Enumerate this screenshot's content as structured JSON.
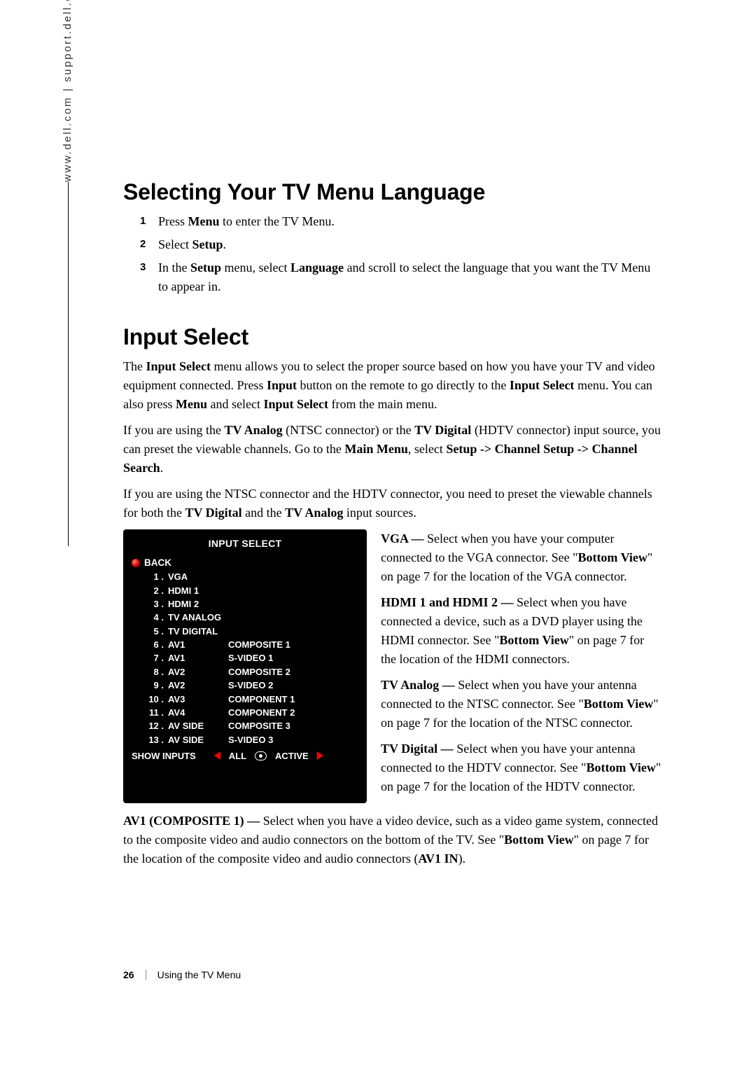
{
  "side_url": "www.dell.com | support.dell.com",
  "h1_a": "Selecting Your TV Menu Language",
  "steps": [
    {
      "n": "1",
      "t": "Press <b>Menu</b> to enter the TV Menu."
    },
    {
      "n": "2",
      "t": "Select <b>Setup</b>."
    },
    {
      "n": "3",
      "t": "In the <b>Setup</b> menu, select <b>Language</b> and scroll to select the language that you want the TV Menu to appear in."
    }
  ],
  "h1_b": "Input Select",
  "p1": "The <b>Input Select</b> menu allows you to select the proper source based on how you have your TV and video equipment connected. Press <b>Input</b> button on the remote to go directly to the <b>Input Select</b> menu. You can also press <b>Menu</b> and select <b>Input Select</b> from the main menu.",
  "p2": "If you are using the <b>TV Analog</b> (NTSC connector) or the <b>TV Digital</b> (HDTV connector) input source, you can preset the viewable channels. Go to the <b>Main Menu</b>, select <b>Setup -> Channel Setup -> Channel Search</b>.",
  "p3": "If you are using the NTSC connector and the HDTV connector, you need to preset the viewable channels for both the <b>TV Digital</b> and the <b>TV Analog</b> input sources.",
  "menu": {
    "title": "INPUT SELECT",
    "back": "BACK",
    "rows": [
      {
        "n": "1 .",
        "l": "VGA",
        "v": ""
      },
      {
        "n": "2 .",
        "l": "HDMI 1",
        "v": ""
      },
      {
        "n": "3 .",
        "l": "HDMI 2",
        "v": ""
      },
      {
        "n": "4 .",
        "l": "TV ANALOG",
        "v": ""
      },
      {
        "n": "5 .",
        "l": "TV DIGITAL",
        "v": ""
      },
      {
        "n": "6 .",
        "l": "AV1",
        "v": "COMPOSITE 1"
      },
      {
        "n": "7 .",
        "l": "AV1",
        "v": "S-VIDEO 1"
      },
      {
        "n": "8 .",
        "l": "AV2",
        "v": "COMPOSITE 2"
      },
      {
        "n": "9 .",
        "l": "AV2",
        "v": "S-VIDEO 2"
      },
      {
        "n": "10 .",
        "l": "AV3",
        "v": "COMPONENT 1"
      },
      {
        "n": "11 .",
        "l": "AV4",
        "v": "COMPONENT 2"
      },
      {
        "n": "12 .",
        "l": "AV SIDE",
        "v": "COMPOSITE 3"
      },
      {
        "n": "13 .",
        "l": "AV SIDE",
        "v": "S-VIDEO 3"
      }
    ],
    "footer_show": "SHOW INPUTS",
    "footer_all": "ALL",
    "footer_active": "ACTIVE"
  },
  "right": {
    "vga": "<b>VGA —</b> Select when you have your computer connected to the VGA connector. See \"<b>Bottom View</b>\" on page 7 for the location of the VGA connector.",
    "hdmi": "<b>HDMI 1 and HDMI 2 —</b> Select when you have connected a device, such as a DVD player using the HDMI connector. See \"<b>Bottom View</b>\" on page 7 for the location of the HDMI connectors.",
    "analog": "<b>TV Analog —</b> Select when you have your antenna connected to the NTSC connector. See \"<b>Bottom View</b>\" on page 7 for the location of the NTSC connector.",
    "digital": "<b>TV Digital —</b> Select when you have your antenna connected to the HDTV connector. See \"<b>Bottom View</b>\" on page 7 for the location of the HDTV connector."
  },
  "post": "<b>AV1 (COMPOSITE 1) —</b> Select when you have a video device, such as a video game system, connected to the composite video and audio connectors on the bottom of the TV. See \"<b>Bottom View</b>\" on page 7 for the location of the composite video and audio connectors (<b>AV1 IN</b>).",
  "footer": {
    "page": "26",
    "section": "Using the TV Menu"
  }
}
